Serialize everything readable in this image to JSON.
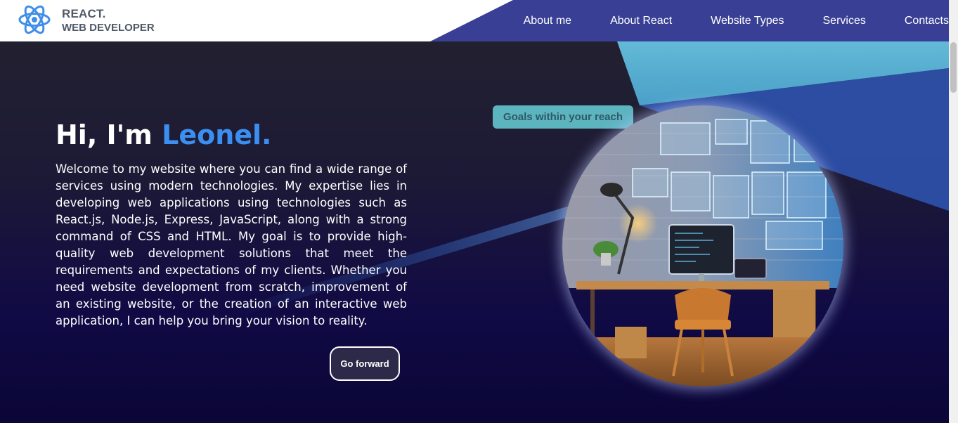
{
  "brand": {
    "title": "REACT.",
    "subtitle": "WEB DEVELOPER",
    "icon": "react-atom-icon"
  },
  "nav": {
    "items": [
      {
        "label": "About me"
      },
      {
        "label": "About React"
      },
      {
        "label": "Website Types"
      },
      {
        "label": "Services"
      },
      {
        "label": "Contacts"
      }
    ]
  },
  "hero": {
    "greeting": "Hi, I'm",
    "name": "Leonel.",
    "description": "Welcome to my website where you can find a wide range of services using modern technologies. My expertise lies in developing web applications using technologies such as React.js, Node.js, Express, JavaScript, along with a strong command of CSS and HTML. My goal is to provide high-quality web development solutions that meet the requirements and expectations of my clients. Whether you need website development from scratch, improvement of an existing website, or the creation of an interactive web application, I can help you bring your vision to reality.",
    "button_label": "Go forward",
    "badge": "Goals within your reach"
  },
  "colors": {
    "accent": "#3b8ff0",
    "nav_bg": "#383f94",
    "teal": "#5cb4bf"
  }
}
